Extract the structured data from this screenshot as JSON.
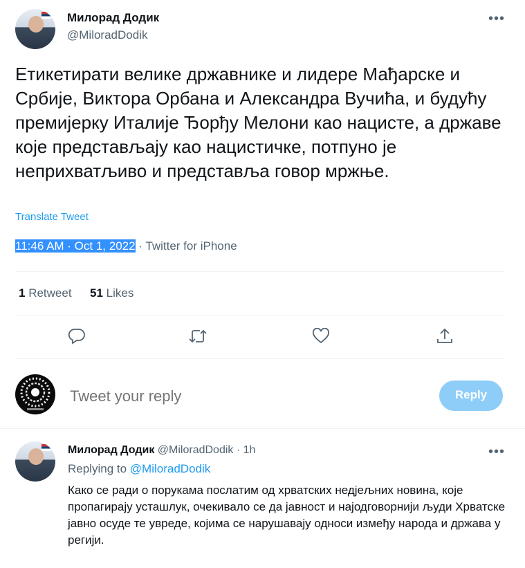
{
  "tweet": {
    "author_name": "Милорад Додик",
    "author_handle": "@MiloradDodik",
    "more_label": "•••",
    "text": "Етикетирати велике државнике и лидере Мађарске и Србије, Виктора Орбана и Александра Вучића, и будућу премијерку Италије Ђорђу Мелони као нацисте, а државе које представљају као нацистичке, потпуно је неприхватљиво и представља говор мржње.",
    "translate_label": "Translate Tweet",
    "timestamp": "11:46 AM · Oct 1, 2022",
    "separator": " · ",
    "source": "Twitter for iPhone",
    "retweet_count": "1",
    "retweet_label": "Retweet",
    "like_count": "51",
    "like_label": "Likes"
  },
  "actions": {
    "icons": [
      "reply-icon",
      "retweet-icon",
      "like-icon",
      "share-icon"
    ]
  },
  "composer": {
    "placeholder": "Tweet your reply",
    "reply_button": "Reply"
  },
  "reply": {
    "author_name": "Милорад Додик",
    "author_handle": "@MiloradDodik",
    "dot": "·",
    "time": "1h",
    "more_label": "•••",
    "replying_label": "Replying to",
    "replying_handle": "@MiloradDodik",
    "text": "Како се ради о порукама послатим од хрватских недјељних новина, које пропагирају усташлук, очекивало се да јавност и најодговорнији људи Хрватске јавно осуде те увреде, којима се нарушавају односи између народа и држава у регији."
  },
  "colors": {
    "accent": "#1d9bf0",
    "secondary_text": "#536471",
    "reply_button_disabled": "#8ecdf8",
    "selection": "#3390ff"
  }
}
